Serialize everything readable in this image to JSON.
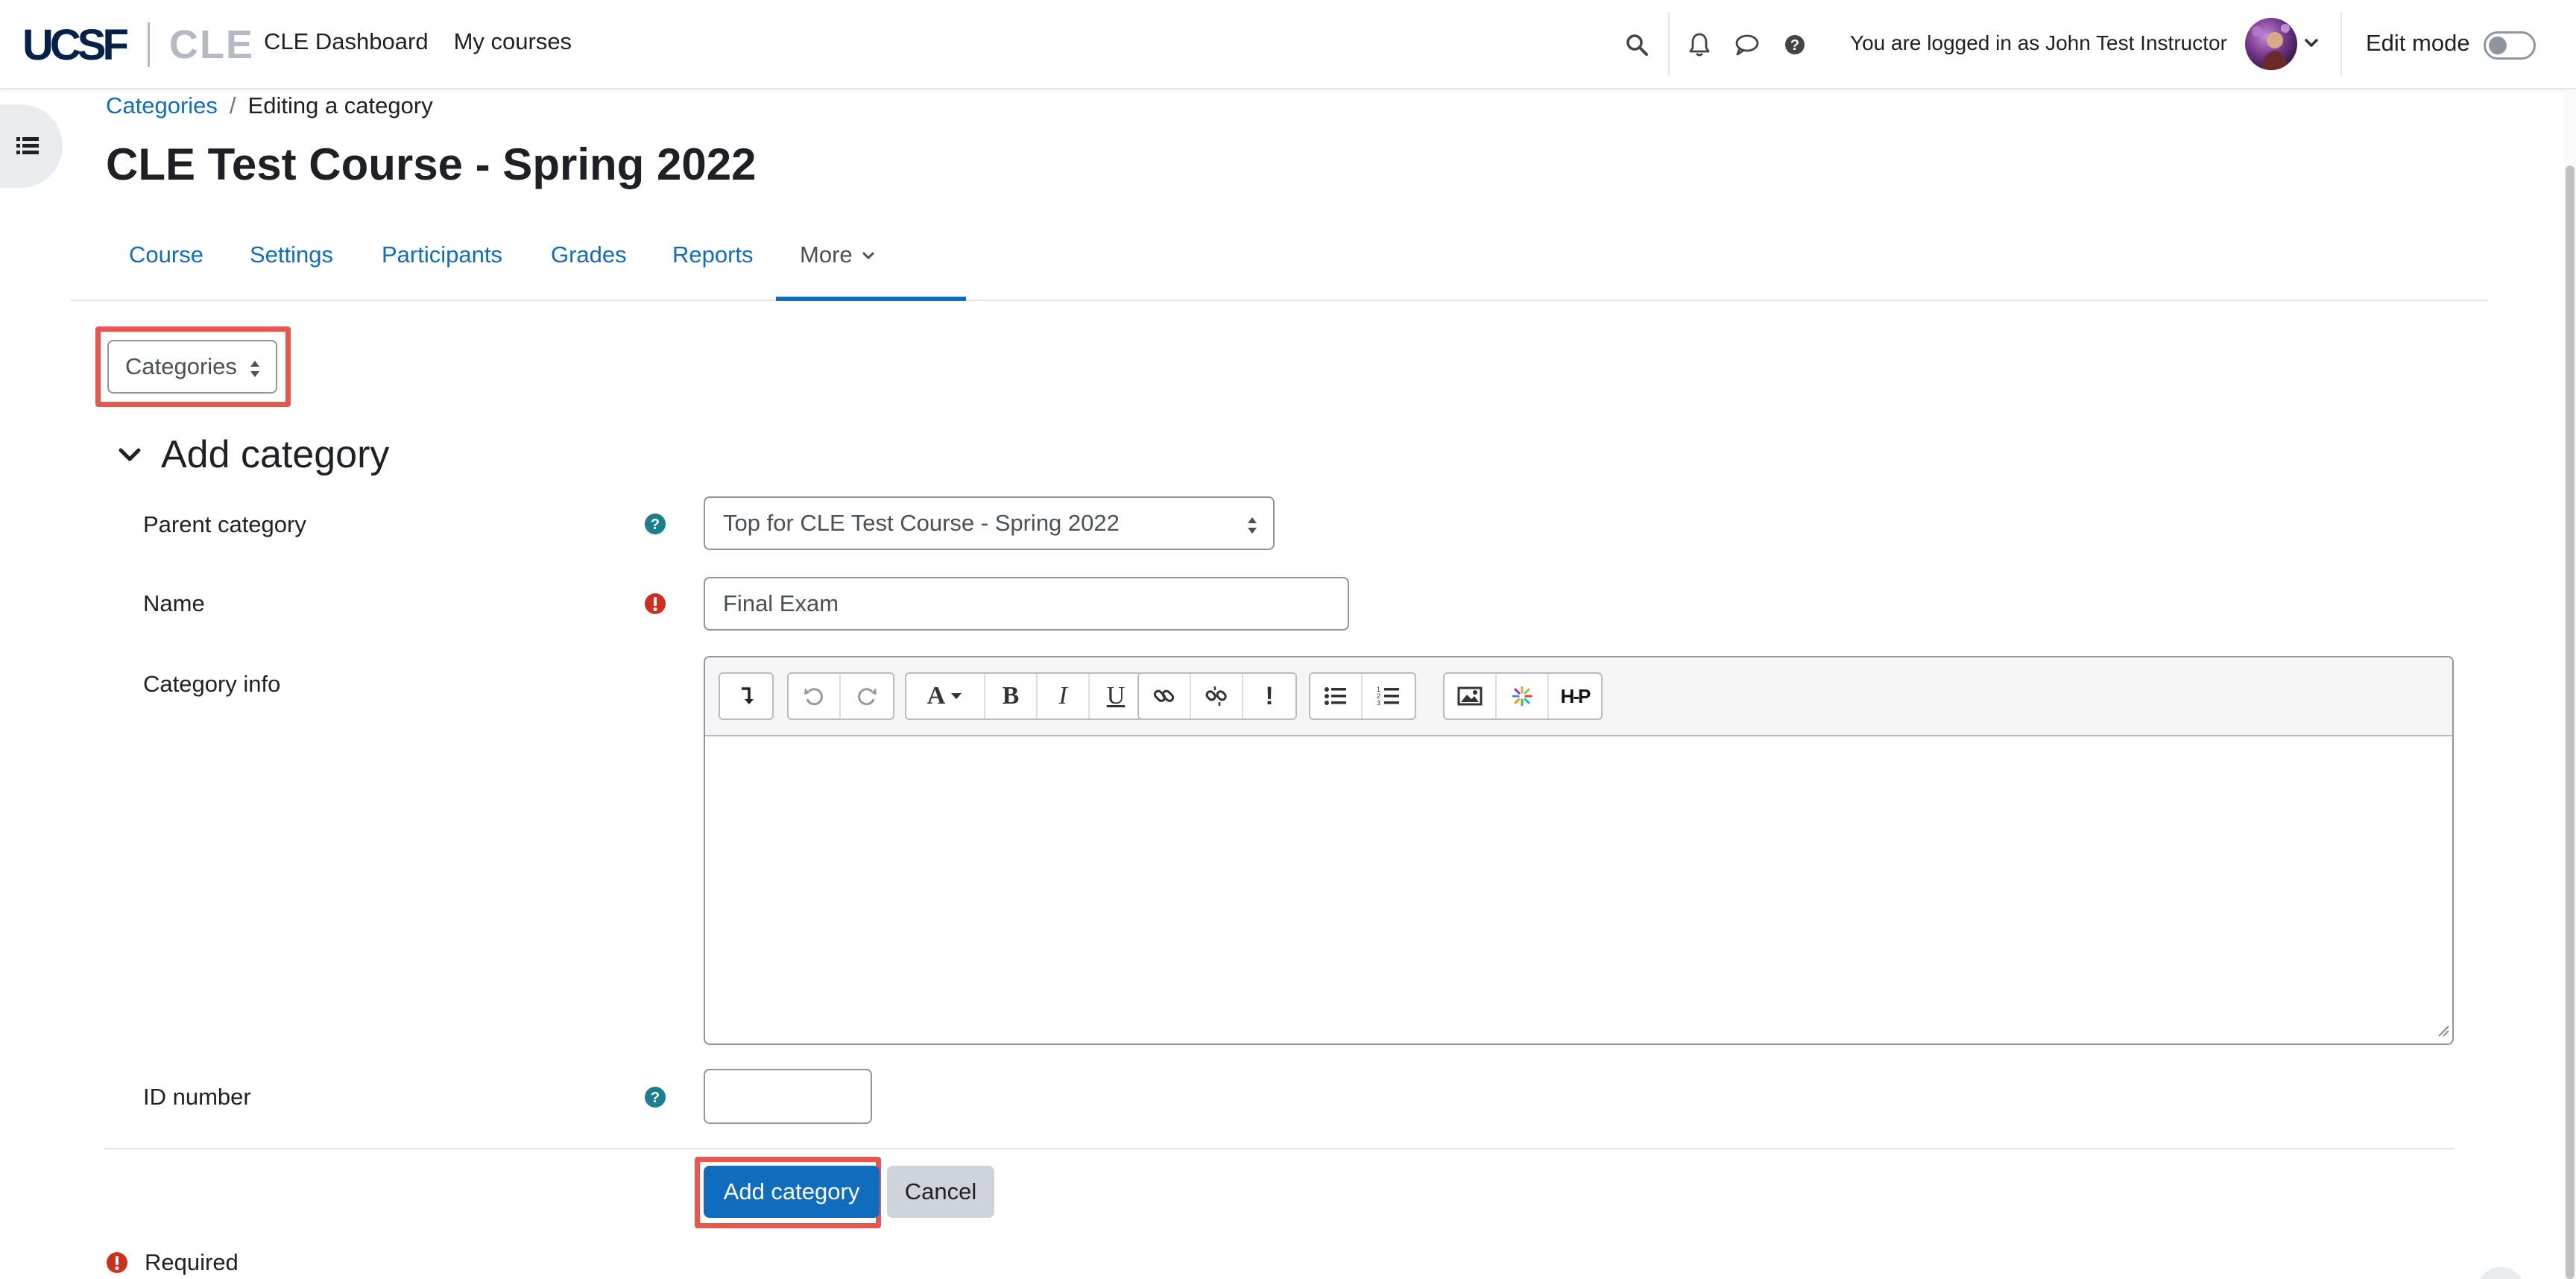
{
  "brand": {
    "logo_main": "UCSF",
    "logo_sub": "CLE"
  },
  "navbar": {
    "links": [
      "CLE Dashboard",
      "My courses"
    ],
    "logged_in_text": "You are logged in as John Test Instructor",
    "edit_mode_label": "Edit mode",
    "edit_mode_on": false,
    "icons": [
      "search-icon",
      "bell-icon",
      "chat-icon",
      "help-icon"
    ]
  },
  "breadcrumb": {
    "items": [
      "Categories",
      "Editing a category"
    ],
    "separator": "/"
  },
  "page": {
    "title": "CLE Test Course - Spring 2022"
  },
  "tabs": [
    "Course",
    "Settings",
    "Participants",
    "Grades",
    "Reports",
    "More"
  ],
  "active_tab": "More",
  "nav_select": {
    "value": "Categories"
  },
  "form": {
    "section_title": "Add category",
    "parent_category": {
      "label": "Parent category",
      "value": "Top for CLE Test Course - Spring 2022"
    },
    "name": {
      "label": "Name",
      "value": "Final Exam"
    },
    "info": {
      "label": "Category info",
      "value": ""
    },
    "idnumber": {
      "label": "ID number",
      "value": ""
    },
    "submit_label": "Add category",
    "cancel_label": "Cancel",
    "required_label": "Required"
  },
  "colors": {
    "link": "#0f6cbf",
    "primary": "#0f6cbf",
    "highlight": "#e8574e",
    "help_icon": "#1a7f8e",
    "required_icon": "#ca3120"
  }
}
